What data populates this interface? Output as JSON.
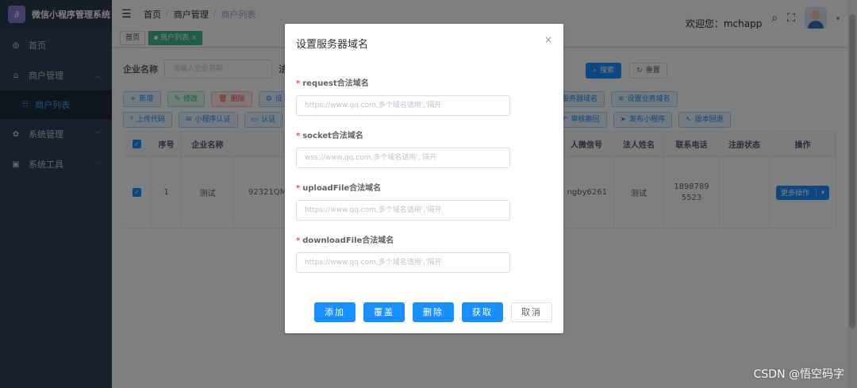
{
  "app": {
    "title": "微信小程序管理系统",
    "logo_glyph": "∂"
  },
  "sidebar": {
    "items": [
      {
        "label": "首页",
        "icon": "dashboard-icon"
      },
      {
        "label": "商户管理",
        "icon": "store-icon"
      },
      {
        "label": "商户列表",
        "icon": "list-icon"
      },
      {
        "label": "系统管理",
        "icon": "gear-icon"
      },
      {
        "label": "系统工具",
        "icon": "toolbox-icon"
      }
    ]
  },
  "header": {
    "breadcrumb": [
      "首页",
      "商户管理",
      "商户列表"
    ],
    "welcome": "欢迎您：mchapp"
  },
  "tags": {
    "home": "首页",
    "active": "商户列表",
    "active_close": "×"
  },
  "search": {
    "label_company": "企业名称",
    "placeholder_company": "请输入企业名称",
    "label_second": "法",
    "search_btn": "搜索",
    "reset_btn": "重置"
  },
  "toolbar": {
    "row1": [
      "新增",
      "修改",
      "删除",
      "设",
      "服务器域名",
      "设置业务域名"
    ],
    "row2": [
      "上传代码",
      "小程序认证",
      "认证",
      "审核撤回",
      "发布小程序",
      "版本回退"
    ]
  },
  "table": {
    "headers": [
      "",
      "序号",
      "企业名称",
      "企",
      "人微信号",
      "法人姓名",
      "联系电话",
      "注册状态",
      "操作"
    ],
    "row": {
      "index": "1",
      "company": "测试",
      "code": "92321QMA",
      "wechat": "ngby6261",
      "legal_name": "测试",
      "phone": "18987895523",
      "status": "",
      "action": "更多操作"
    }
  },
  "dialog": {
    "title": "设置服务器域名",
    "close": "×",
    "fields": [
      {
        "label": "request合法域名",
        "placeholder": "https://www.qq.com,多个域名请用','隔开"
      },
      {
        "label": "socket合法域名",
        "placeholder": "wss://www.qq.com,多个域名请用','隔开"
      },
      {
        "label": "uploadFile合法域名",
        "placeholder": "https://www.qq.com,多个域名请用','隔开"
      },
      {
        "label": "downloadFile合法域名",
        "placeholder": "https://www.qq.com,多个域名请用','隔开"
      }
    ],
    "buttons": {
      "add": "添加",
      "cover": "覆盖",
      "delete": "删除",
      "fetch": "获取",
      "cancel": "取消"
    }
  },
  "watermark": "CSDN @悟空码字",
  "colors": {
    "primary": "#1890ff",
    "sidebar": "#304156",
    "active_tag": "#42b983",
    "required": "#ff4949"
  }
}
